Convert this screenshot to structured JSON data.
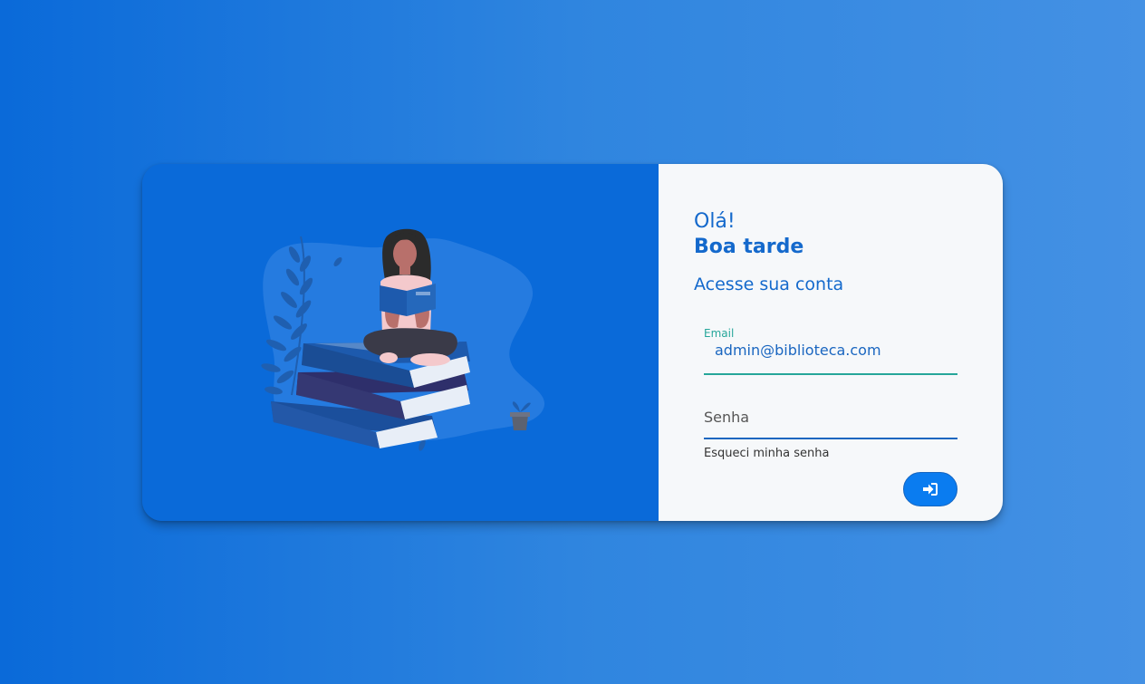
{
  "login": {
    "greeting": "Olá!",
    "greeting_time": "Boa tarde",
    "subtitle": "Acesse sua conta",
    "email": {
      "label": "Email",
      "value": "admin@biblioteca.com"
    },
    "password": {
      "placeholder": "Senha"
    },
    "forgot_link": "Esqueci minha senha",
    "submit_icon": "sign-in-icon"
  },
  "illustration": {
    "subject": "woman-reading-on-books-illustration"
  },
  "colors": {
    "background_start": "#0a6ad9",
    "background_end": "#4491e4",
    "panel_left": "#0a6ad9",
    "panel_right": "#f6f8fa",
    "accent": "#1469cc",
    "field_active": "#26a69a",
    "button": "#0a7cf0"
  }
}
